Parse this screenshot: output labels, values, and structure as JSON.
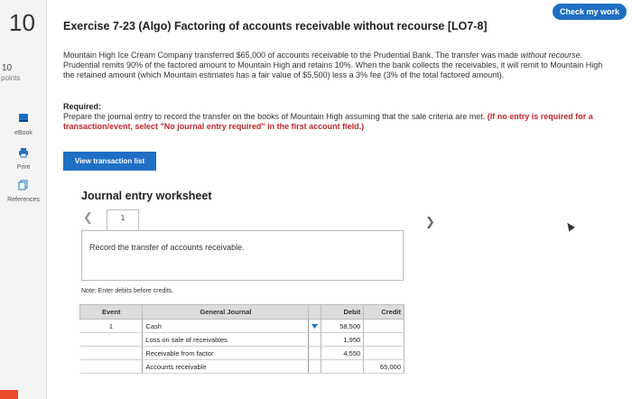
{
  "question": {
    "number": "10",
    "points_value": "10",
    "points_label": "points"
  },
  "rail": {
    "ebook_label": "eBook",
    "print_label": "Print",
    "references_label": "References"
  },
  "check_button": "Check my work",
  "exercise_title": "Exercise 7-23 (Algo) Factoring of accounts receivable without recourse [LO7-8]",
  "problem": {
    "part1": "Mountain High Ice Cream Company transferred $65,000 of accounts receivable to the Prudential Bank. The transfer was made ",
    "emph": "without recourse.",
    "part2": " Prudential remits 90% of the factored amount to Mountain High and retains 10%. When the bank collects the receivables, it will remit to Mountain High the retained amount (which Mountain estimates has a fair value of $5,500) less a 3% fee (3% of the total factored amount)."
  },
  "required": {
    "label": "Required:",
    "text": "Prepare the journal entry to record the transfer on the books of Mountain High assuming that the sale criteria are met. ",
    "note": "(If no entry is required for a transaction/event, select \"No journal entry required\" in the first account field.)"
  },
  "view_button": "View transaction list",
  "worksheet": {
    "title": "Journal entry worksheet",
    "page_number": "1",
    "instruction": "Record the transfer of accounts receivable.",
    "note": "Note: Enter debits before credits."
  },
  "journal": {
    "headers": {
      "event": "Event",
      "general_journal": "General Journal",
      "debit": "Debit",
      "credit": "Credit"
    },
    "rows": [
      {
        "event": "1",
        "account": "Cash",
        "debit": "58,500",
        "credit": ""
      },
      {
        "event": "",
        "account": "Loss on sale of receivables",
        "debit": "1,950",
        "credit": ""
      },
      {
        "event": "",
        "account": "Receivable from factor",
        "debit": "4,550",
        "credit": ""
      },
      {
        "event": "",
        "account": "Accounts receivable",
        "debit": "",
        "credit": "65,000"
      }
    ]
  },
  "colors": {
    "accent_blue": "#1f6fc4",
    "required_red": "#c0272d"
  }
}
